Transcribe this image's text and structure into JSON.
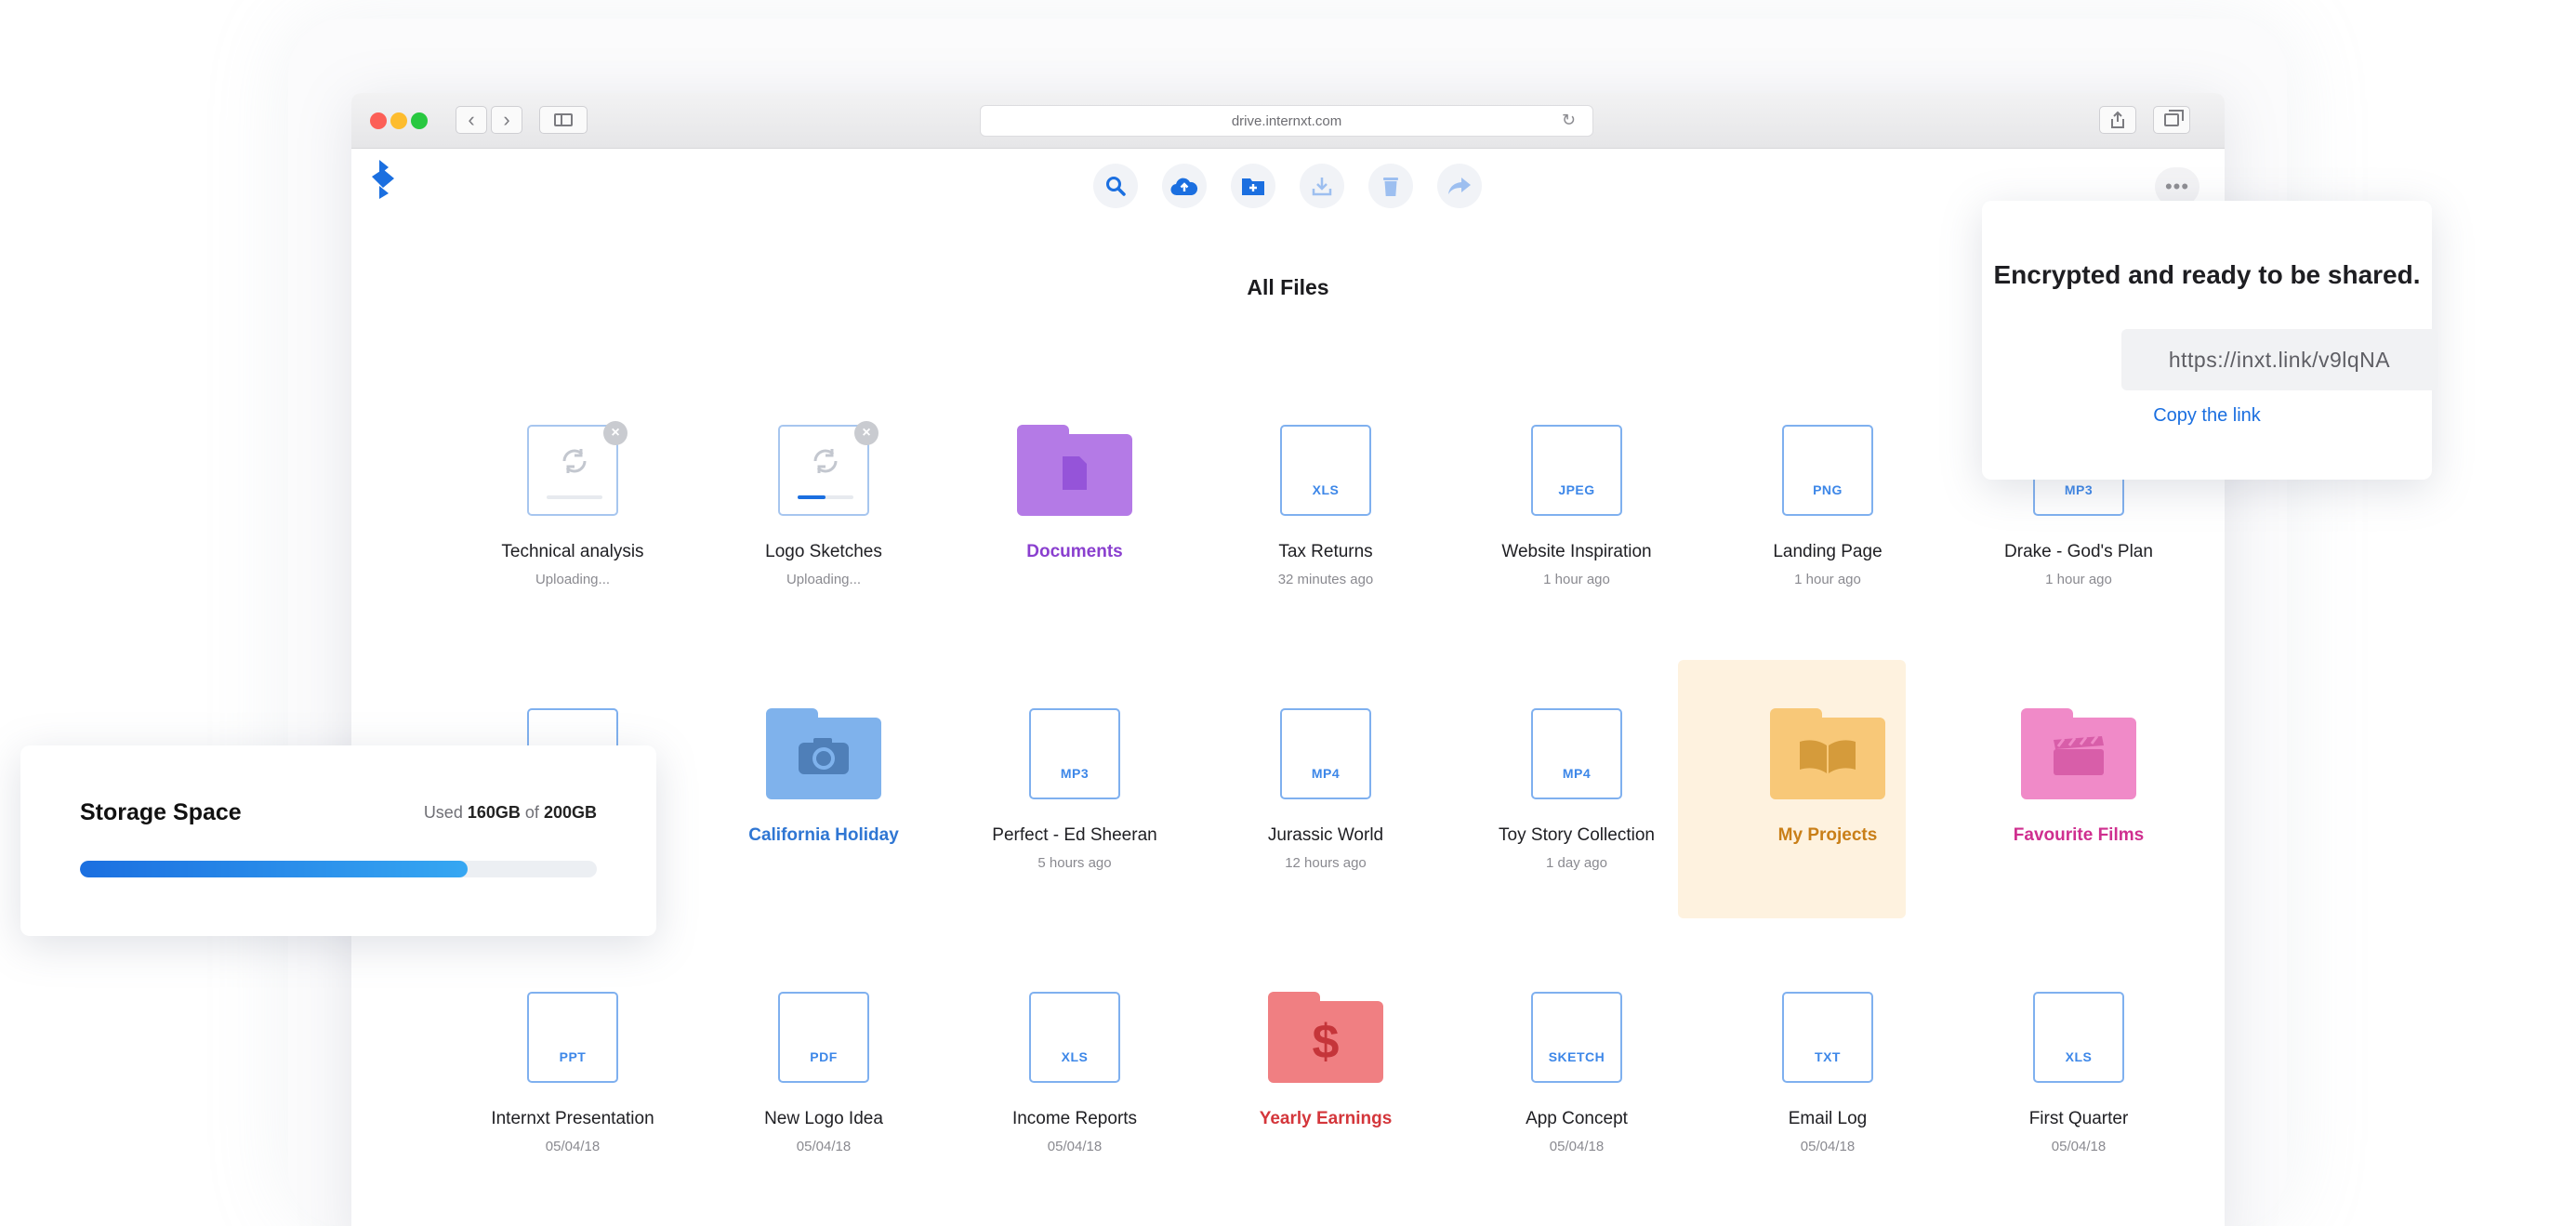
{
  "browser": {
    "url": "drive.internxt.com"
  },
  "app": {
    "page_title": "All Files",
    "toolbar_icons": [
      "search-icon",
      "upload-cloud-icon",
      "new-folder-icon",
      "download-icon",
      "trash-icon",
      "share-icon"
    ],
    "more_label": "•••"
  },
  "files": [
    {
      "name": "Technical analysis",
      "meta": "Uploading...",
      "kind": "uploading",
      "progress": 0.0
    },
    {
      "name": "Logo Sketches",
      "meta": "Uploading...",
      "kind": "uploading",
      "progress": 0.5
    },
    {
      "name": "Documents",
      "meta": "",
      "kind": "folder",
      "color": "#b47ae6",
      "label_color": "#8a3fcf",
      "glyph": "document"
    },
    {
      "name": "Tax Returns",
      "meta": "32 minutes ago",
      "kind": "file",
      "ext": "XLS"
    },
    {
      "name": "Website Inspiration",
      "meta": "1 hour ago",
      "kind": "file",
      "ext": "JPEG"
    },
    {
      "name": "Landing Page",
      "meta": "1 hour ago",
      "kind": "file",
      "ext": "PNG"
    },
    {
      "name": "Drake - God's Plan",
      "meta": "1 hour ago",
      "kind": "file",
      "ext": "MP3"
    },
    {
      "name": "",
      "meta": "",
      "kind": "file",
      "ext": ""
    },
    {
      "name": "California Holiday",
      "meta": "",
      "kind": "folder",
      "color": "#7fb2ec",
      "label_color": "#2f76d3",
      "glyph": "camera"
    },
    {
      "name": "Perfect - Ed Sheeran",
      "meta": "5 hours ago",
      "kind": "file",
      "ext": "MP3"
    },
    {
      "name": "Jurassic World",
      "meta": "12 hours ago",
      "kind": "file",
      "ext": "MP4"
    },
    {
      "name": "Toy Story Collection",
      "meta": "1 day ago",
      "kind": "file",
      "ext": "MP4"
    },
    {
      "name": "My Projects",
      "meta": "",
      "kind": "folder",
      "color": "#f8c878",
      "label_color": "#c97f18",
      "glyph": "book"
    },
    {
      "name": "Favourite Films",
      "meta": "",
      "kind": "folder",
      "color": "#f08ac8",
      "label_color": "#cf2f8f",
      "glyph": "clapper"
    },
    {
      "name": "Internxt Presentation",
      "meta": "05/04/18",
      "kind": "file",
      "ext": "PPT"
    },
    {
      "name": "New Logo Idea",
      "meta": "05/04/18",
      "kind": "file",
      "ext": "PDF"
    },
    {
      "name": "Income Reports",
      "meta": "05/04/18",
      "kind": "file",
      "ext": "XLS"
    },
    {
      "name": "Yearly Earnings",
      "meta": "",
      "kind": "folder",
      "color": "#f07f82",
      "label_color": "#d4363b",
      "glyph": "dollar"
    },
    {
      "name": "App Concept",
      "meta": "05/04/18",
      "kind": "file",
      "ext": "SKETCH"
    },
    {
      "name": "Email Log",
      "meta": "05/04/18",
      "kind": "file",
      "ext": "TXT"
    },
    {
      "name": "First Quarter",
      "meta": "05/04/18",
      "kind": "file",
      "ext": "XLS"
    }
  ],
  "share_card": {
    "heading": "Encrypted and ready to be shared.",
    "link": "https://inxt.link/v9lqNA",
    "copy_label": "Copy the link"
  },
  "storage_card": {
    "title": "Storage Space",
    "used_prefix": "Used",
    "used_amount": "160GB",
    "used_of": "of",
    "total_amount": "200GB",
    "fraction_used": 0.75
  },
  "colors": {
    "accent": "#1b6fe0",
    "file_ext": "#3d87e8"
  }
}
